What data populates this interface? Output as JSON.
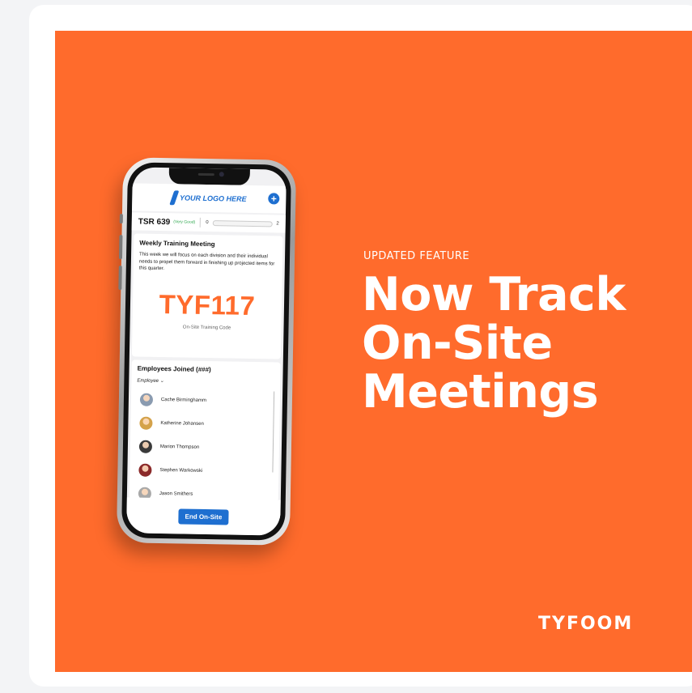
{
  "phone_app": {
    "logo_text": "YOUR LOGO HERE",
    "add_button": "+",
    "tsr": {
      "label": "TSR 639",
      "rating": "(Very Good)",
      "min": "0",
      "max": "2"
    },
    "meeting": {
      "title": "Weekly Training Meeting",
      "description": "This week we will focus on each division and their individual needs to propel them forward in finishing up projected items for this quarter.",
      "code": "TYF117",
      "code_caption": "On-Site Training Code"
    },
    "employees": {
      "title": "Employees Joined (###)",
      "filter_label": "Employee",
      "list": [
        {
          "name": "Cache Birminghamm",
          "avatar_color": "#8a9bb0"
        },
        {
          "name": "Katherine Johansen",
          "avatar_color": "#d4a24a"
        },
        {
          "name": "Marion Thompson",
          "avatar_color": "#3a3a3a"
        },
        {
          "name": "Stephen Warkowski",
          "avatar_color": "#8b2a2a"
        },
        {
          "name": "Jason Smithers",
          "avatar_color": "#a8a8a8"
        }
      ]
    },
    "end_button": "End On-Site"
  },
  "eyebrow": "UPDATED FEATURE",
  "headline": [
    "Now Track",
    "On-Site",
    "Meetings"
  ],
  "brand": "TYFOOM",
  "colors": {
    "accent": "#ff6b2c",
    "app_blue": "#1e6fd0",
    "rating_green": "#2fa84f"
  }
}
